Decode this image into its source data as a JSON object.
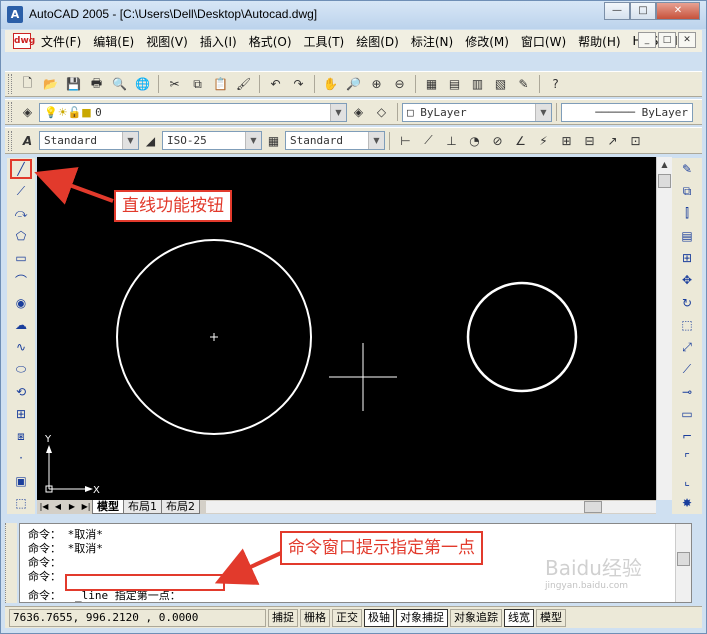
{
  "window": {
    "app_icon": "A",
    "title": "AutoCAD 2005 - [C:\\Users\\Dell\\Desktop\\Autocad.dwg]",
    "minimize": "—",
    "maximize": "□",
    "close": "✕"
  },
  "menubar": {
    "doc_icon": "dwg",
    "items": [
      "文件(F)",
      "编辑(E)",
      "视图(V)",
      "插入(I)",
      "格式(O)",
      "工具(T)",
      "绘图(D)",
      "标注(N)",
      "修改(M)",
      "窗口(W)",
      "帮助(H)",
      "HDSHM"
    ],
    "doc_controls": [
      "_",
      "□",
      "✕"
    ]
  },
  "toolbar_standard": {
    "icons": [
      "new-icon",
      "open-icon",
      "save-icon",
      "print-icon",
      "preview-icon",
      "publish-icon",
      "cut-icon",
      "copy-icon",
      "paste-icon",
      "match-properties-icon",
      "undo-icon",
      "redo-icon",
      "pan-icon",
      "zoom-realtime-icon",
      "zoom-window-icon",
      "zoom-previous-icon",
      "properties-icon",
      "design-center-icon",
      "tool-palettes-icon",
      "dbconnect-icon",
      "markup-icon",
      "help-icon"
    ],
    "glyphs": [
      "🗋",
      "📂",
      "💾",
      "🖶",
      "🔍",
      "🌐",
      "✂",
      "⧉",
      "📋",
      "🖌",
      "↶",
      "↷",
      "✋",
      "🔎",
      "⊕",
      "⊖",
      "▦",
      "▤",
      "▥",
      "▧",
      "✎",
      "?"
    ]
  },
  "toolbar_layers": {
    "layer_value": "0",
    "color_value": "ByLayer",
    "linetype_value": "ByLayer"
  },
  "toolbar_styles": {
    "text_style": "Standard",
    "dim_style": "ISO-25",
    "table_style": "Standard"
  },
  "draw_toolbar": {
    "glyphs": [
      "╱",
      "⟋",
      "⤼",
      "⬠",
      "▭",
      "⌒",
      "◉",
      "☁",
      "∿",
      "⬭",
      "⟲",
      "⊞",
      "⧆",
      "·",
      "▣",
      "⬚"
    ],
    "icons": [
      "line-icon",
      "construction-line-icon",
      "polyline-icon",
      "polygon-icon",
      "rectangle-icon",
      "arc-icon",
      "circle-icon",
      "revcloud-icon",
      "spline-icon",
      "ellipse-icon",
      "ellipse-arc-icon",
      "insert-block-icon",
      "make-block-icon",
      "point-icon",
      "hatch-icon",
      "region-icon"
    ]
  },
  "modify_toolbar": {
    "glyphs": [
      "✎",
      "⧉",
      "⫿",
      "▤",
      "⊞",
      "✥",
      "↻",
      "⬚",
      "⤢",
      "⟋",
      "⊸",
      "▭",
      "⌐",
      "⌜",
      "⌞",
      "✸"
    ],
    "icons": [
      "erase-icon",
      "copy-object-icon",
      "mirror-icon",
      "offset-icon",
      "array-icon",
      "move-icon",
      "rotate-icon",
      "scale-icon",
      "stretch-icon",
      "trim-icon",
      "extend-icon",
      "break-icon",
      "break-at-point-icon",
      "chamfer-icon",
      "fillet-icon",
      "explode-icon"
    ]
  },
  "canvas": {
    "ucs_x": "X",
    "ucs_y": "Y"
  },
  "tabs": {
    "items": [
      "模型",
      "布局1",
      "布局2"
    ],
    "active": "模型",
    "nav": [
      "|◀",
      "◀",
      "▶",
      "▶|"
    ]
  },
  "command": {
    "lines": [
      "命令： *取消*",
      "命令： *取消*",
      "命令：",
      "命令："
    ],
    "prompt": "命令：",
    "input": "_line 指定第一点："
  },
  "status": {
    "coords": "7636.7655, 996.2120 , 0.0000",
    "toggles": [
      {
        "label": "捕捉",
        "on": false
      },
      {
        "label": "栅格",
        "on": false
      },
      {
        "label": "正交",
        "on": false
      },
      {
        "label": "极轴",
        "on": true
      },
      {
        "label": "对象捕捉",
        "on": true
      },
      {
        "label": "对象追踪",
        "on": false
      },
      {
        "label": "线宽",
        "on": true
      },
      {
        "label": "模型",
        "on": false
      }
    ]
  },
  "annotations": {
    "callout_line_button": "直线功能按钮",
    "callout_command_window": "命令窗口提示指定第一点",
    "accent_color": "#e23a2c"
  },
  "watermark": {
    "text": "Baidu经验",
    "sub": "jingyan.baidu.com"
  }
}
